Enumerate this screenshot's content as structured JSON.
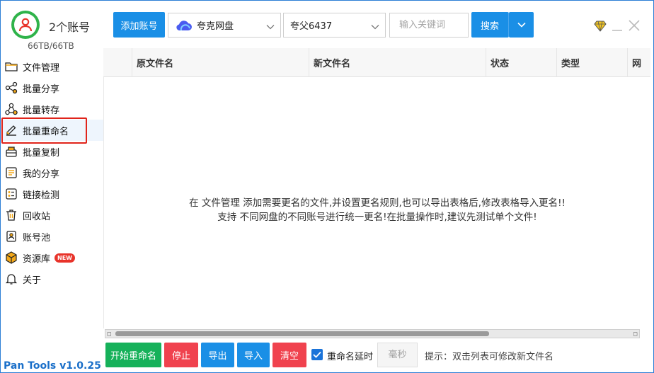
{
  "header": {
    "account_count": "2个账号",
    "storage": "66TB/66TB"
  },
  "toolbar": {
    "add_account": "添加账号",
    "drive_select": "夸克网盘",
    "account_select": "夸父6437",
    "keyword_placeholder": "输入关键词",
    "search": "搜索"
  },
  "sidebar": {
    "items": [
      {
        "label": "文件管理",
        "icon": "folder-icon"
      },
      {
        "label": "批量分享",
        "icon": "share-icon"
      },
      {
        "label": "批量转存",
        "icon": "transfer-icon"
      },
      {
        "label": "批量重命名",
        "icon": "rename-icon"
      },
      {
        "label": "批量复制",
        "icon": "copy-icon"
      },
      {
        "label": "我的分享",
        "icon": "my-share-icon"
      },
      {
        "label": "链接检测",
        "icon": "link-check-icon"
      },
      {
        "label": "回收站",
        "icon": "trash-icon"
      },
      {
        "label": "账号池",
        "icon": "account-pool-icon"
      },
      {
        "label": "资源库",
        "icon": "resource-icon",
        "badge": "NEW"
      },
      {
        "label": "关于",
        "icon": "bell-icon"
      }
    ],
    "active_index": 3
  },
  "table": {
    "columns": [
      "原文件名",
      "新文件名",
      "状态",
      "类型",
      "网"
    ],
    "empty_line1": "在 文件管理 添加需要更名的文件,并设置更名规则,也可以导出表格后,修改表格导入更名!!",
    "empty_line2": "支持 不同网盘的不同账号进行统一更名!在批量操作时,建议先测试单个文件!"
  },
  "footer": {
    "start": "开始重命名",
    "stop": "停止",
    "export": "导出",
    "import": "导入",
    "clear": "清空",
    "delay_label": "重命名延时",
    "delay_checked": true,
    "ms_placeholder": "毫秒",
    "hint": "提示：双击列表可修改新文件名"
  },
  "version": "Pan Tools v1.0.25",
  "colors": {
    "primary": "#1a8fe6",
    "success": "#16b15a",
    "danger": "#f0424e",
    "highlight_border": "#e0241b",
    "version_text": "#1a6fc9"
  }
}
